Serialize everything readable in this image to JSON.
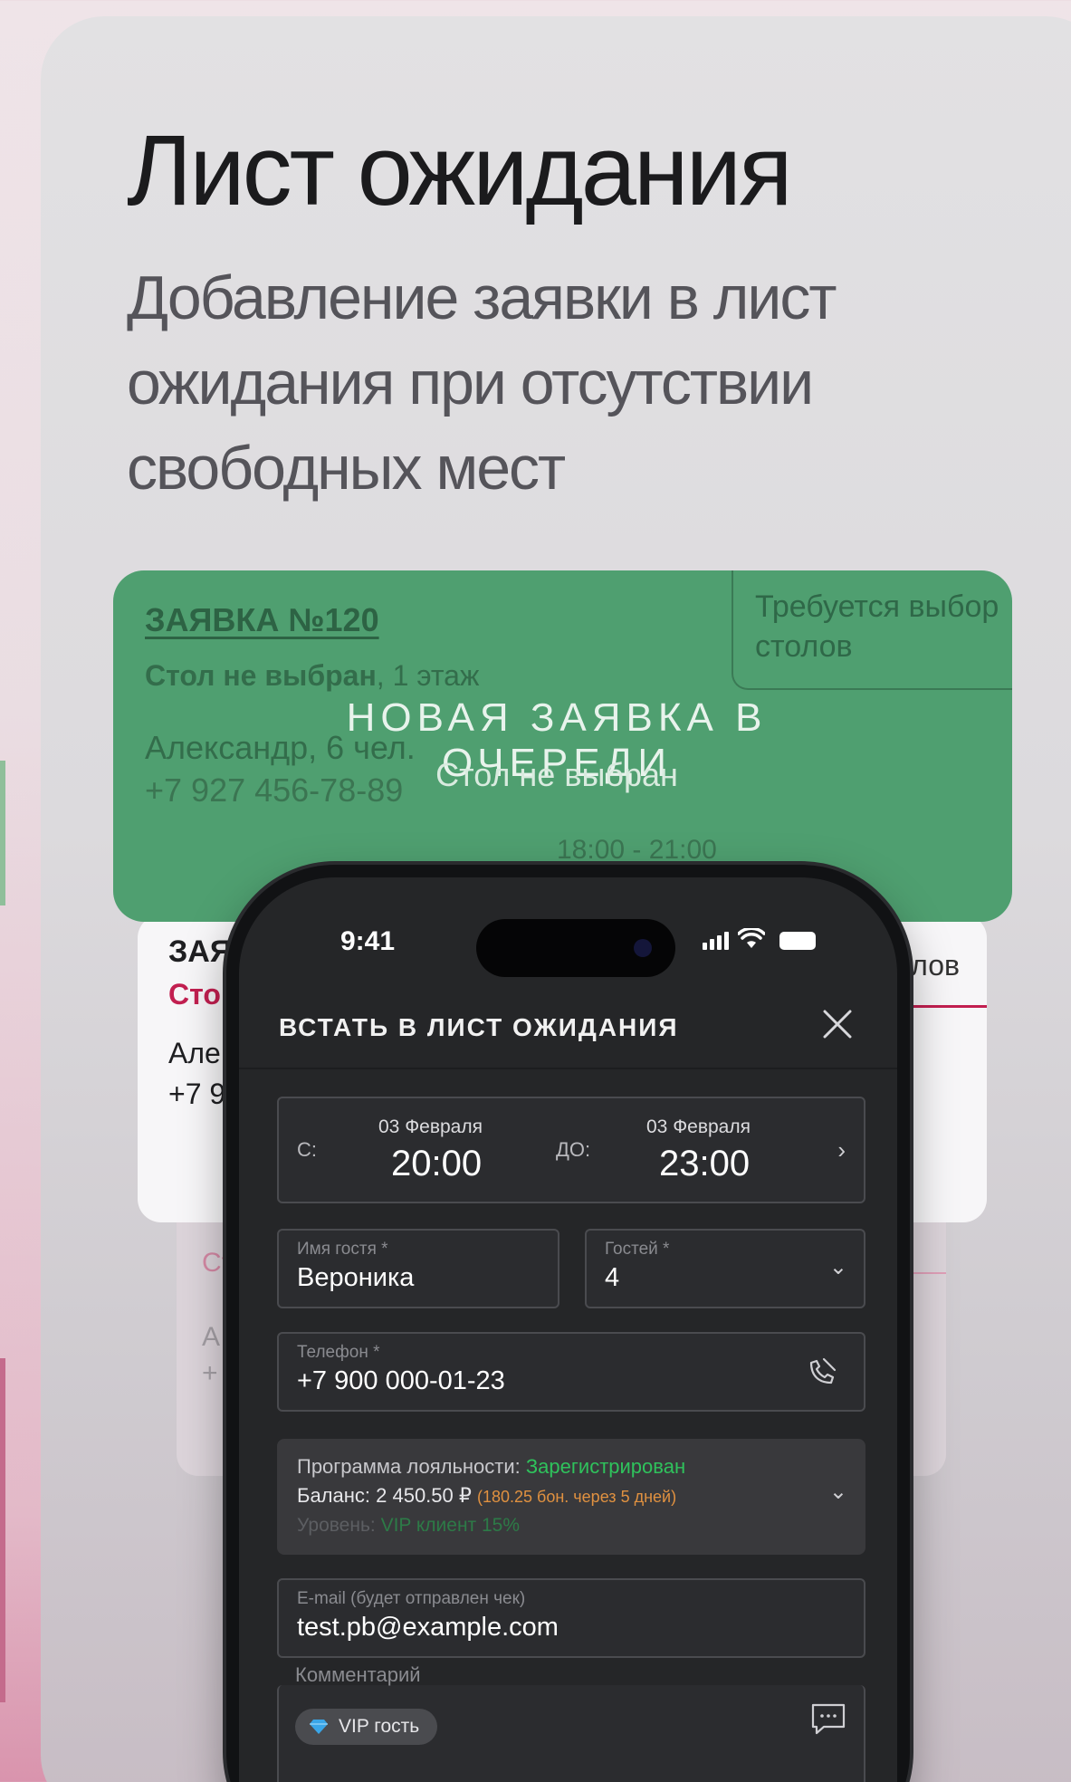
{
  "header": {
    "title": "Лист ожидания",
    "subtitle": "Добавление заявки в лист ожидания при отсутствии свободных мест"
  },
  "green_card": {
    "ticket": "ЗАЯВКА №120",
    "table_bold": "Стол не выбран",
    "table_floor": ", 1 этаж",
    "guest": "Александр, 6 чел.",
    "phone": "+7 927 456-78-89",
    "time": "18:00 - 21:00",
    "requirement": "Требуется выбор столов",
    "notice_title": "НОВАЯ ЗАЯВКА В ОЧЕРЕДИ",
    "notice_sub": "Стол не выбран"
  },
  "white_card": {
    "title": "ЗАЯВ",
    "status": "Сто",
    "name": "Але",
    "phone": "+7 9",
    "right": "лов"
  },
  "lower_card": {
    "a": "Ст",
    "b": "А",
    "c": "+"
  },
  "phone": {
    "clock": "9:41",
    "screen_title": "ВСТАТЬ В ЛИСТ ОЖИДАНИЯ",
    "date": {
      "from_label": "С:",
      "from_month": "03 Февраля",
      "from_time": "20:00",
      "to_label": "ДО:",
      "to_month": "03 Февраля",
      "to_time": "23:00"
    },
    "name_field": {
      "label": "Имя гостя *",
      "value": "Вероника"
    },
    "guests_field": {
      "label": "Гостей *",
      "value": "4"
    },
    "phone_field": {
      "label": "Телефон *",
      "value": "+7 900 000-01-23"
    },
    "loyalty": {
      "program_label": "Программа лояльности: ",
      "program_status": "Зарегистрирован",
      "balance_label": "Баланс: 2 450.50 ₽ ",
      "bonus": "(180.25 бон. через 5 дней)",
      "level_label": "Уровень: ",
      "level_value": "VIP клиент 15%"
    },
    "email_field": {
      "label": "E-mail (будет отправлен чек)",
      "value": "test.pb@example.com"
    },
    "comment_field": {
      "label": "Комментарий",
      "chip": "VIP гость"
    }
  },
  "colors": {
    "green_card": "#4f9f70",
    "accent_red": "#c21f50",
    "loyalty_green": "#2fc25c",
    "bonus_orange": "#e09140"
  }
}
